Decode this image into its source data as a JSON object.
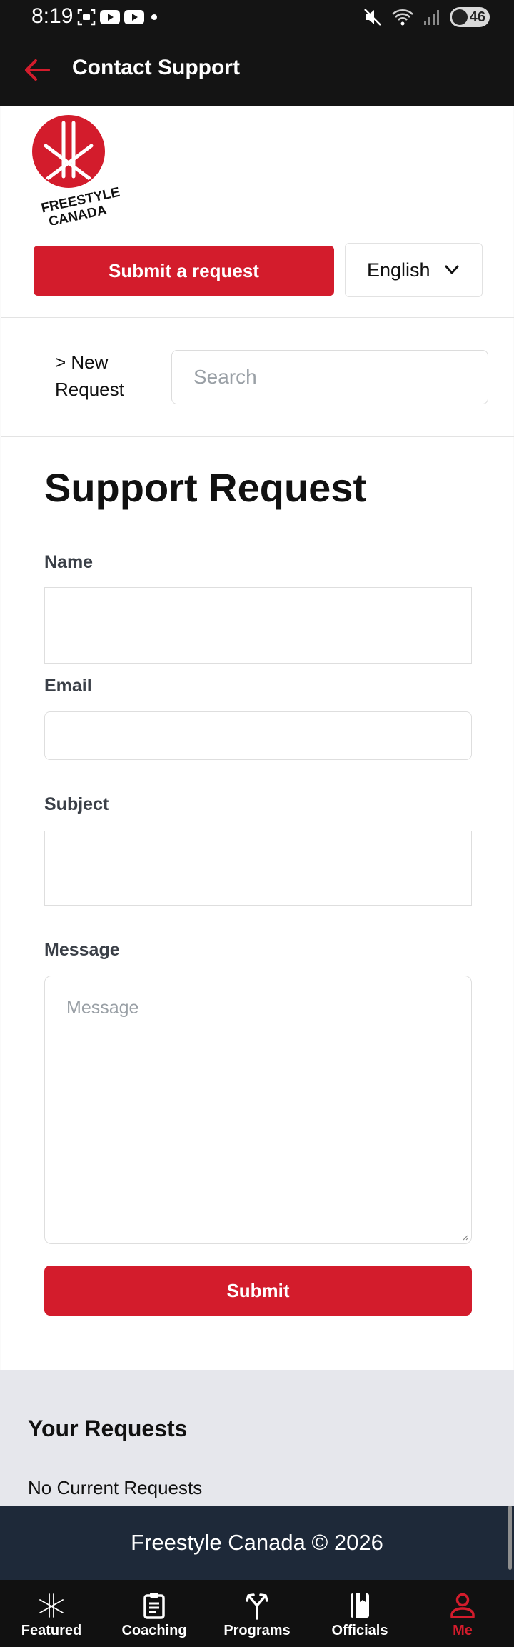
{
  "status_bar": {
    "time": "8:19",
    "battery": "46"
  },
  "app_bar": {
    "title": "Contact Support"
  },
  "logo": {
    "line1": "FREESTYLE",
    "line2": "CANADA"
  },
  "header": {
    "submit_request_label": "Submit a request",
    "language_selected": "English"
  },
  "breadcrumb": {
    "line1": "> New",
    "line2": "Request"
  },
  "search": {
    "placeholder": "Search"
  },
  "form": {
    "title": "Support Request",
    "name_label": "Name",
    "email_label": "Email",
    "subject_label": "Subject",
    "message_label": "Message",
    "message_placeholder": "Message",
    "submit_label": "Submit"
  },
  "requests": {
    "title": "Your Requests",
    "empty_text": "No Current Requests"
  },
  "footer": {
    "text": "Freestyle Canada © 2026"
  },
  "bottom_nav": {
    "items": [
      {
        "label": "Featured",
        "icon": "featured-icon"
      },
      {
        "label": "Coaching",
        "icon": "clipboard-icon"
      },
      {
        "label": "Programs",
        "icon": "programs-icon"
      },
      {
        "label": "Officials",
        "icon": "book-icon"
      },
      {
        "label": "Me",
        "icon": "person-icon"
      }
    ],
    "active_index": 4
  },
  "colors": {
    "brand_red": "#d31c2c",
    "app_bar": "#141414",
    "footer": "#1e2939",
    "requests_bg": "#e6e7ec"
  }
}
